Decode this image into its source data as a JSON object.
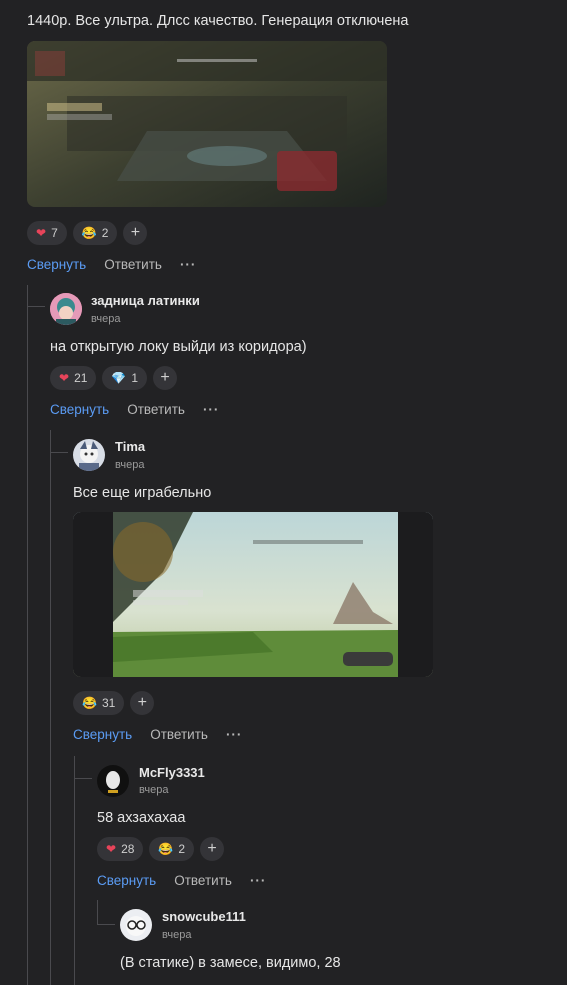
{
  "root": {
    "text": "1440р. Все ультра. Длсс качество. Генерация отключена",
    "reactions": [
      {
        "icon": "heart-icon",
        "glyph": "❤",
        "color": "#e8445a",
        "count": "7"
      },
      {
        "icon": "laughing-emoji-icon",
        "glyph": "😂",
        "color": "#f3c33c",
        "count": "2"
      }
    ],
    "actions": {
      "collapse": "Свернуть",
      "reply": "Ответить",
      "more": "···"
    }
  },
  "c1": {
    "author": "задница латинки",
    "time": "вчера",
    "text": "на открытую локу выйди из коридора)",
    "reactions": [
      {
        "icon": "heart-icon",
        "glyph": "❤",
        "color": "#e8445a",
        "count": "21"
      },
      {
        "icon": "diamond-icon",
        "glyph": "💎",
        "color": "#3aa0f0",
        "count": "1"
      }
    ],
    "actions": {
      "collapse": "Свернуть",
      "reply": "Ответить",
      "more": "···"
    }
  },
  "c2": {
    "author": "Tima",
    "time": "вчера",
    "text": "Все еще играбельно",
    "reactions": [
      {
        "icon": "laughing-emoji-icon",
        "glyph": "😂",
        "color": "#f3c33c",
        "count": "31"
      }
    ],
    "actions": {
      "collapse": "Свернуть",
      "reply": "Ответить",
      "more": "···"
    }
  },
  "c3": {
    "author": "McFly3331",
    "time": "вчера",
    "text": "58 ахзахахаа",
    "reactions": [
      {
        "icon": "heart-icon",
        "glyph": "❤",
        "color": "#e8445a",
        "count": "28"
      },
      {
        "icon": "laughing-emoji-icon",
        "glyph": "😂",
        "color": "#f3c33c",
        "count": "2"
      }
    ],
    "actions": {
      "collapse": "Свернуть",
      "reply": "Ответить",
      "more": "···"
    }
  },
  "c4": {
    "author": "snowcube111",
    "time": "вчера",
    "text": "(В статике) в замесе, видимо, 28"
  },
  "add_glyph": "+"
}
